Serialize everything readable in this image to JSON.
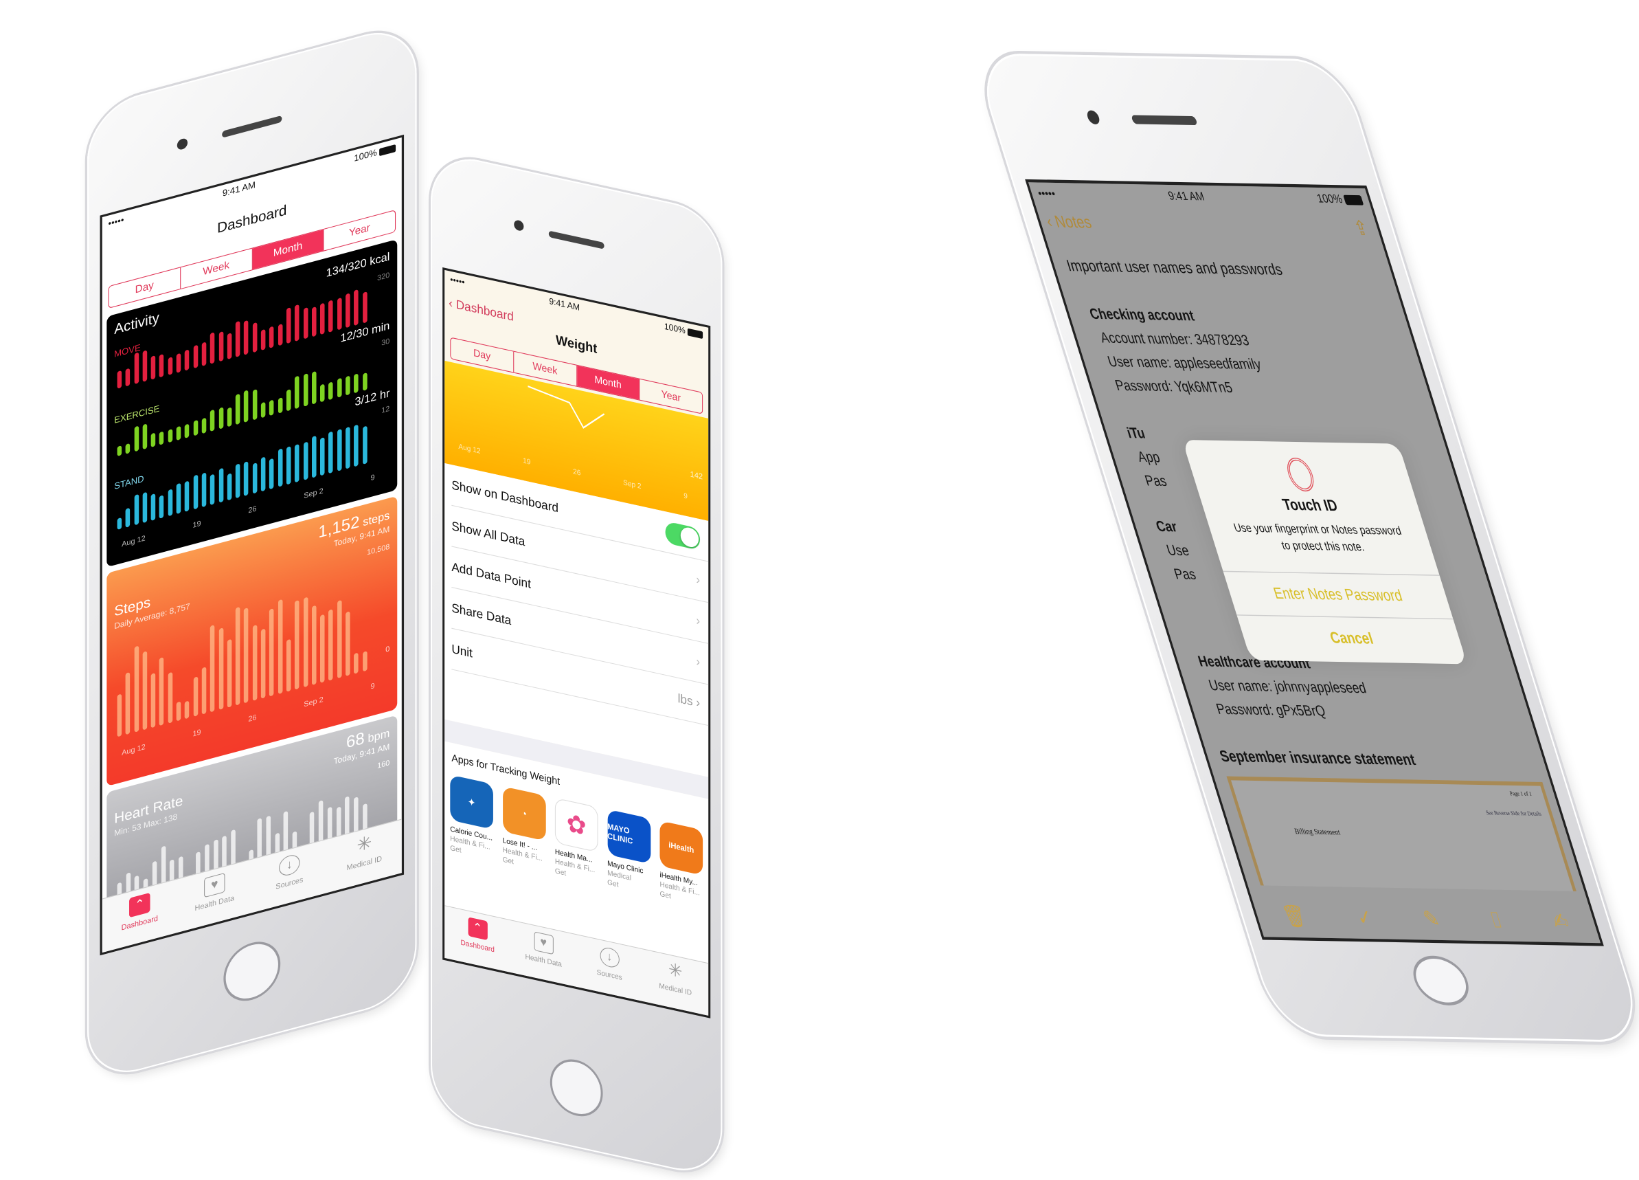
{
  "status": {
    "carrier": "•••••",
    "time": "9:41 AM",
    "battery": "100%"
  },
  "health_dashboard": {
    "title": "Dashboard",
    "segments": [
      "Day",
      "Week",
      "Month",
      "Year"
    ],
    "selected_segment": "Month",
    "activity": {
      "title": "Activity",
      "move": {
        "label": "MOVE",
        "value": "134/320 kcal",
        "max": "320",
        "color": "#e3203f",
        "values": [
          150,
          150,
          260,
          260,
          200,
          190,
          150,
          160,
          170,
          190,
          200,
          260,
          250,
          220,
          300,
          290,
          250,
          170,
          180,
          180,
          300,
          310,
          260,
          250,
          260,
          270,
          270,
          290,
          300,
          260
        ]
      },
      "exercise": {
        "label": "EXERCISE",
        "value": "12/30 min",
        "max": "30",
        "color": "#7ed321",
        "values": [
          8,
          8,
          20,
          20,
          11,
          10,
          10,
          11,
          11,
          12,
          12,
          17,
          17,
          15,
          24,
          25,
          24,
          12,
          12,
          12,
          17,
          26,
          26,
          26,
          14,
          14,
          15,
          15,
          15,
          14
        ]
      },
      "stand": {
        "label": "STAND",
        "value": "3/12 hr",
        "max": "12",
        "color": "#2bb8dc",
        "values": [
          3,
          5,
          8,
          8,
          7,
          6,
          7,
          8,
          8,
          9,
          9,
          8,
          9,
          7,
          9,
          9,
          8,
          9,
          8,
          10,
          10,
          10,
          10,
          11,
          10,
          11,
          11,
          11,
          11,
          10
        ]
      },
      "axis": [
        "Aug 12",
        "19",
        "26",
        "Sep 2",
        "9"
      ]
    },
    "steps": {
      "title": "Steps",
      "subtitle": "Daily Average: 8,757",
      "value": "1,152",
      "unit": "steps",
      "time": "Today, 9:41 AM",
      "max": "10,508",
      "min": "0",
      "color": "#f4502c",
      "values": [
        4500,
        6600,
        9200,
        8400,
        5800,
        7300,
        5400,
        2000,
        1900,
        4200,
        5000,
        9300,
        8700,
        7300,
        10500,
        10200,
        8100,
        7400,
        9400,
        10100,
        5600,
        9500,
        9600,
        8500,
        7300,
        7600,
        8300,
        6900,
        2200,
        2100
      ],
      "axis": [
        "Aug 12",
        "19",
        "26",
        "Sep 2",
        "9"
      ]
    },
    "heart_rate": {
      "title": "Heart Rate",
      "subtitle": "Min: 53  Max: 138",
      "value": "68",
      "unit": "bpm",
      "time": "Today, 9:41 AM",
      "max": "160",
      "ranges": [
        [
          55,
          80
        ],
        [
          55,
          95
        ],
        [
          57,
          85
        ],
        [
          54,
          75
        ],
        [
          58,
          105
        ],
        [
          59,
          130
        ],
        [
          58,
          98
        ],
        [
          56,
          100
        ],
        [
          0,
          0
        ],
        [
          60,
          100
        ],
        [
          60,
          110
        ],
        [
          60,
          115
        ],
        [
          60,
          118
        ],
        [
          60,
          125
        ],
        [
          0,
          0
        ],
        [
          62,
          76
        ],
        [
          62,
          135
        ],
        [
          62,
          135
        ],
        [
          62,
          95
        ],
        [
          62,
          135
        ],
        [
          64,
          90
        ],
        [
          0,
          0
        ],
        [
          64,
          120
        ],
        [
          64,
          138
        ],
        [
          64,
          120
        ],
        [
          64,
          115
        ],
        [
          64,
          132
        ],
        [
          70,
          125
        ],
        [
          72,
          108
        ]
      ]
    },
    "tabs": [
      "Dashboard",
      "Health Data",
      "Sources",
      "Medical ID"
    ]
  },
  "weight": {
    "back": "Dashboard",
    "title": "Weight",
    "segments": [
      "Day",
      "Week",
      "Month",
      "Year"
    ],
    "selected_segment": "Month",
    "chart": {
      "axis": [
        "Aug 12",
        "19",
        "26",
        "Sep 2",
        "9"
      ],
      "max": "142"
    },
    "rows": [
      {
        "label": "Show on Dashboard",
        "toggle": true
      },
      {
        "label": "Show All Data"
      },
      {
        "label": "Add Data Point"
      },
      {
        "label": "Share Data"
      },
      {
        "label": "Unit",
        "value": "lbs"
      }
    ],
    "apps_header": "Apps for Tracking Weight",
    "apps": [
      {
        "name": "Calorie Cou...",
        "category": "Health & Fi...",
        "action": "Get",
        "color": "#1565b8",
        "glyph": "✦"
      },
      {
        "name": "Lose It! - ...",
        "category": "Health & Fi...",
        "action": "Get",
        "color": "#f29127",
        "glyph": "◔"
      },
      {
        "name": "Health Ma...",
        "category": "Health & Fi...",
        "action": "Get",
        "color": "#ffffff",
        "glyph": "✿"
      },
      {
        "name": "Mayo Clinic",
        "category": "Medical",
        "action": "Get",
        "color": "#0a52c8",
        "glyph": "MAYO CLINIC"
      },
      {
        "name": "iHealth My...",
        "category": "Health & Fi...",
        "action": "Get",
        "color": "#f07a1a",
        "glyph": "iHealth"
      }
    ],
    "tabs": [
      "Dashboard",
      "Health Data",
      "Sources",
      "Medical ID"
    ]
  },
  "notes": {
    "back": "Notes",
    "title": "Important user names and passwords",
    "checking": {
      "heading": "Checking account",
      "lines": [
        "Account number: 34878293",
        "User name: appleseedfamily",
        "Password: Yqk6MTn5"
      ]
    },
    "hidden_partial": [
      "iTu",
      "App",
      "Pas",
      "Car",
      "Use",
      "Pas"
    ],
    "healthcare": {
      "heading": "Healthcare account",
      "lines": [
        "User name: johnnyappleseed",
        "Password: gPx5BrQ"
      ]
    },
    "statement": {
      "heading": "September insurance statement",
      "doc_title": "Billing Statement",
      "page": "Page 1 of 1",
      "note": "See Reverse Side for Details"
    },
    "alert": {
      "title": "Touch ID",
      "message": "Use your fingerprint or Notes password to protect this note.",
      "primary": "Enter Notes Password",
      "cancel": "Cancel",
      "accent": "#d8bf2a"
    }
  }
}
